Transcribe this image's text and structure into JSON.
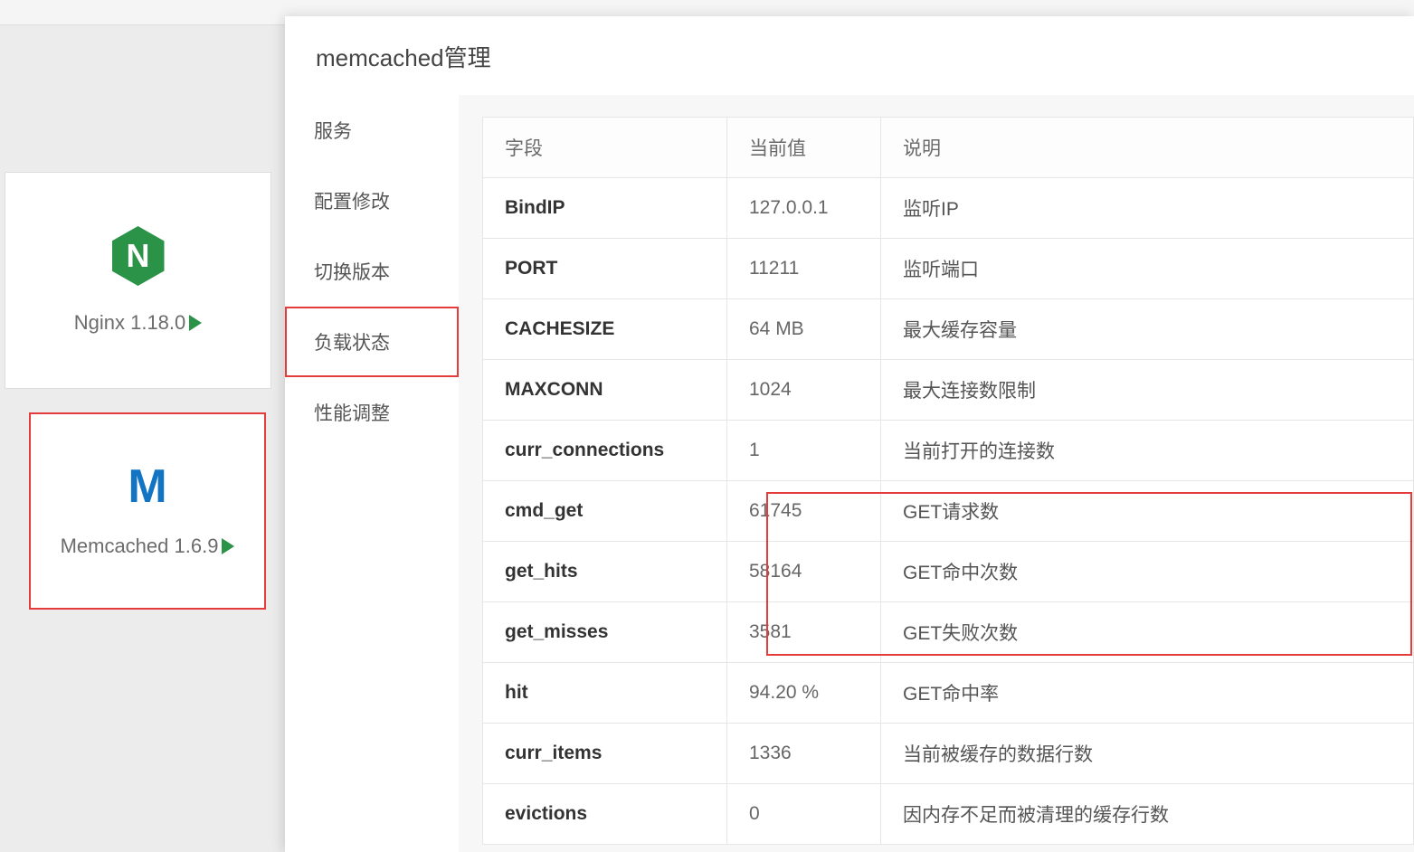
{
  "cards": {
    "nginx": {
      "label": "Nginx 1.18.0",
      "icon_letter": "N"
    },
    "memcached": {
      "label": "Memcached 1.6.9",
      "icon_letter": "M"
    }
  },
  "modal": {
    "title": "memcached管理",
    "sidebar": [
      {
        "label": "服务"
      },
      {
        "label": "配置修改"
      },
      {
        "label": "切换版本"
      },
      {
        "label": "负载状态"
      },
      {
        "label": "性能调整"
      }
    ],
    "table": {
      "headers": {
        "field": "字段",
        "value": "当前值",
        "desc": "说明"
      },
      "rows": [
        {
          "field": "BindIP",
          "value": "127.0.0.1",
          "desc": "监听IP"
        },
        {
          "field": "PORT",
          "value": "11211",
          "desc": "监听端口"
        },
        {
          "field": "CACHESIZE",
          "value": "64 MB",
          "desc": "最大缓存容量"
        },
        {
          "field": "MAXCONN",
          "value": "1024",
          "desc": "最大连接数限制"
        },
        {
          "field": "curr_connections",
          "value": "1",
          "desc": "当前打开的连接数"
        },
        {
          "field": "cmd_get",
          "value": "61745",
          "desc": "GET请求数"
        },
        {
          "field": "get_hits",
          "value": "58164",
          "desc": "GET命中次数"
        },
        {
          "field": "get_misses",
          "value": "3581",
          "desc": "GET失败次数"
        },
        {
          "field": "hit",
          "value": "94.20 %",
          "desc": "GET命中率"
        },
        {
          "field": "curr_items",
          "value": "1336",
          "desc": "当前被缓存的数据行数"
        },
        {
          "field": "evictions",
          "value": "0",
          "desc": "因内存不足而被清理的缓存行数"
        }
      ]
    }
  }
}
